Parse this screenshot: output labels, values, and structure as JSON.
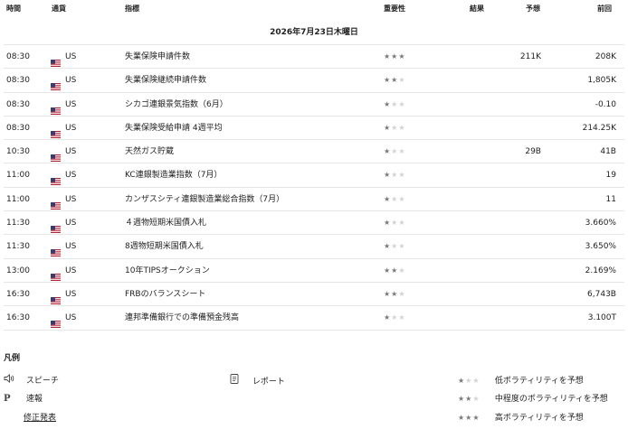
{
  "columns": {
    "time": "時間",
    "currency": "通貨",
    "indicator": "指標",
    "importance": "重要性",
    "result": "結果",
    "forecast": "予想",
    "previous": "前回"
  },
  "date_header": "2026年7月23日木曜日",
  "events": [
    {
      "time": "08:30",
      "currency": "US",
      "indicator": "失業保険申請件数",
      "stars": 3,
      "result": "",
      "forecast": "211K",
      "previous": "208K"
    },
    {
      "time": "08:30",
      "currency": "US",
      "indicator": "失業保険継続申請件数",
      "stars": 2,
      "result": "",
      "forecast": "",
      "previous": "1,805K"
    },
    {
      "time": "08:30",
      "currency": "US",
      "indicator": "シカゴ連銀景気指数（6月）",
      "stars": 1,
      "result": "",
      "forecast": "",
      "previous": "-0.10"
    },
    {
      "time": "08:30",
      "currency": "US",
      "indicator": "失業保険受給申請 4週平均",
      "stars": 1,
      "result": "",
      "forecast": "",
      "previous": "214.25K"
    },
    {
      "time": "10:30",
      "currency": "US",
      "indicator": "天然ガス貯蔵",
      "stars": 1,
      "result": "",
      "forecast": "29B",
      "previous": "41B"
    },
    {
      "time": "11:00",
      "currency": "US",
      "indicator": "KC連銀製造業指数（7月）",
      "stars": 1,
      "result": "",
      "forecast": "",
      "previous": "19"
    },
    {
      "time": "11:00",
      "currency": "US",
      "indicator": "カンザスシティ連銀製造業総合指数（7月）",
      "stars": 1,
      "result": "",
      "forecast": "",
      "previous": "11"
    },
    {
      "time": "11:30",
      "currency": "US",
      "indicator": "４週物短期米国債入札",
      "stars": 1,
      "result": "",
      "forecast": "",
      "previous": "3.660%"
    },
    {
      "time": "11:30",
      "currency": "US",
      "indicator": "8週物短期米国債入札",
      "stars": 1,
      "result": "",
      "forecast": "",
      "previous": "3.650%"
    },
    {
      "time": "13:00",
      "currency": "US",
      "indicator": "10年TIPSオークション",
      "stars": 2,
      "result": "",
      "forecast": "",
      "previous": "2.169%"
    },
    {
      "time": "16:30",
      "currency": "US",
      "indicator": "FRBのバランスシート",
      "stars": 2,
      "result": "",
      "forecast": "",
      "previous": "6,743B"
    },
    {
      "time": "16:30",
      "currency": "US",
      "indicator": "連邦準備銀行での準備預金残高",
      "stars": 1,
      "result": "",
      "forecast": "",
      "previous": "3.100T"
    }
  ],
  "legend": {
    "title": "凡例",
    "speech": "スピーチ",
    "report": "レポート",
    "preliminary": "速報",
    "revision": "修正発表",
    "low": "低ボラティリティを予想",
    "medium": "中程度のボラティリティを予想",
    "high": "高ボラティリティを予想"
  },
  "icons": {
    "speech": "speaker-icon",
    "report": "document-icon",
    "preliminary": "p-letter-icon",
    "flag": "us-flag-icon",
    "star": "star-icon"
  },
  "colors": {
    "star_on": "#7a7a7a",
    "star_off": "#d2d2d2",
    "divider": "#e6e6e6"
  }
}
